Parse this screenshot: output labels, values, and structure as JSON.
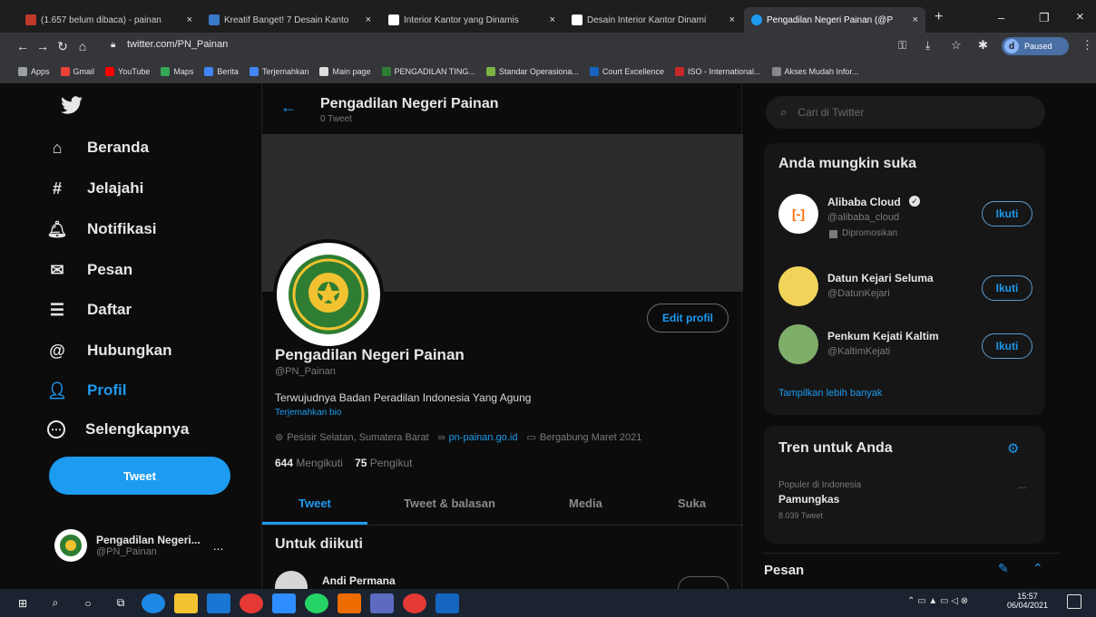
{
  "browser": {
    "tabs": [
      {
        "title": "(1.657 belum dibaca) - painan",
        "close": "×",
        "color": "#c0392b"
      },
      {
        "title": "Kreatif Banget! 7 Desain Kanto",
        "close": "×",
        "color": "#3a78c8"
      },
      {
        "title": "Interior Kantor yang Dinamis",
        "close": "×",
        "color": "#ffffff"
      },
      {
        "title": "Desain Interior Kantor Dinami",
        "close": "×",
        "color": "#ffffff"
      },
      {
        "title": "Pengadilan Negeri Painan (@P",
        "close": "×",
        "color": "#1d9bf0"
      }
    ],
    "new_tab": "+",
    "window_controls": [
      "–",
      "❐",
      "×"
    ],
    "url": "twitter.com/PN_Painan",
    "profile_badge": "Paused",
    "profile_initial": "d",
    "bookmarks": [
      {
        "label": "Apps",
        "color": "#9aa0a6"
      },
      {
        "label": "Gmail",
        "color": "#ea4335"
      },
      {
        "label": "YouTube",
        "color": "#ff0000"
      },
      {
        "label": "Maps",
        "color": "#34a853"
      },
      {
        "label": "Berita",
        "color": "#4285f4"
      },
      {
        "label": "Terjemahkan",
        "color": "#4285f4"
      },
      {
        "label": "Main page",
        "color": "#dddddd"
      },
      {
        "label": "PENGADILAN TING...",
        "color": "#2e7d32"
      },
      {
        "label": "Standar Operasiona...",
        "color": "#7cb342"
      },
      {
        "label": "Court Excellence",
        "color": "#1565c0"
      },
      {
        "label": "ISO - International...",
        "color": "#c62828"
      },
      {
        "label": "Akses Mudah Infor...",
        "color": "#888888"
      }
    ]
  },
  "sidebar": {
    "items": [
      {
        "label": "Beranda",
        "icon": "home-icon",
        "glyph": "⌂"
      },
      {
        "label": "Jelajahi",
        "icon": "hashtag-icon",
        "glyph": "#"
      },
      {
        "label": "Notifikasi",
        "icon": "bell-icon",
        "glyph": "🔔︎"
      },
      {
        "label": "Pesan",
        "icon": "mail-icon",
        "glyph": "✉"
      },
      {
        "label": "Daftar",
        "icon": "list-icon",
        "glyph": "☰"
      },
      {
        "label": "Hubungkan",
        "icon": "at-icon",
        "glyph": "@"
      },
      {
        "label": "Profil",
        "icon": "user-icon",
        "glyph": "👤︎"
      },
      {
        "label": "Selengkapnya",
        "icon": "more-icon",
        "glyph": "⋯"
      }
    ],
    "tweet_button": "Tweet",
    "account": {
      "name": "Pengadilan Negeri...",
      "handle": "@PN_Painan",
      "more": "..."
    }
  },
  "profile": {
    "header_name": "Pengadilan Negeri Painan",
    "tweet_count": "0 Tweet",
    "name": "Pengadilan Negeri Painan",
    "handle": "@PN_Painan",
    "bio": "Terwujudnya Badan Peradilan Indonesia Yang Agung",
    "translate": "Terjemahkan bio",
    "location": "Pesisir Selatan, Sumatera Barat",
    "website": "pn-painan.go.id",
    "joined": "Bergabung Maret 2021",
    "following_count": "644",
    "following_label": "Mengikuti",
    "followers_count": "75",
    "followers_label": "Pengikut",
    "edit_button": "Edit profil",
    "tabs": [
      "Tweet",
      "Tweet & balasan",
      "Media",
      "Suka"
    ],
    "section_title": "Untuk diikuti",
    "suggestion_name": "Andi Permana"
  },
  "right": {
    "search_placeholder": "Cari di Twitter",
    "suggest_title": "Anda mungkin suka",
    "suggestions": [
      {
        "name": "Alibaba Cloud",
        "handle": "@alibaba_cloud",
        "promo": "Dipromosikan",
        "button": "Ikuti"
      },
      {
        "name": "Datun Kejari Seluma",
        "handle": "@DatunKejari",
        "button": "Ikuti"
      },
      {
        "name": "Penkum Kejati Kaltim",
        "handle": "@KaltimKejati",
        "button": "Ikuti"
      }
    ],
    "show_more": "Tampilkan lebih banyak",
    "trends_title": "Tren untuk Anda",
    "trend": {
      "context": "Populer di Indonesia",
      "name": "Pamungkas",
      "count": "8.039 Tweet",
      "more": "..."
    },
    "messages_title": "Pesan"
  },
  "taskbar": {
    "time": "15:57",
    "date": "06/04/2021"
  },
  "colors": {
    "accent": "#1d9bf0",
    "background": "#0c0c0c"
  }
}
